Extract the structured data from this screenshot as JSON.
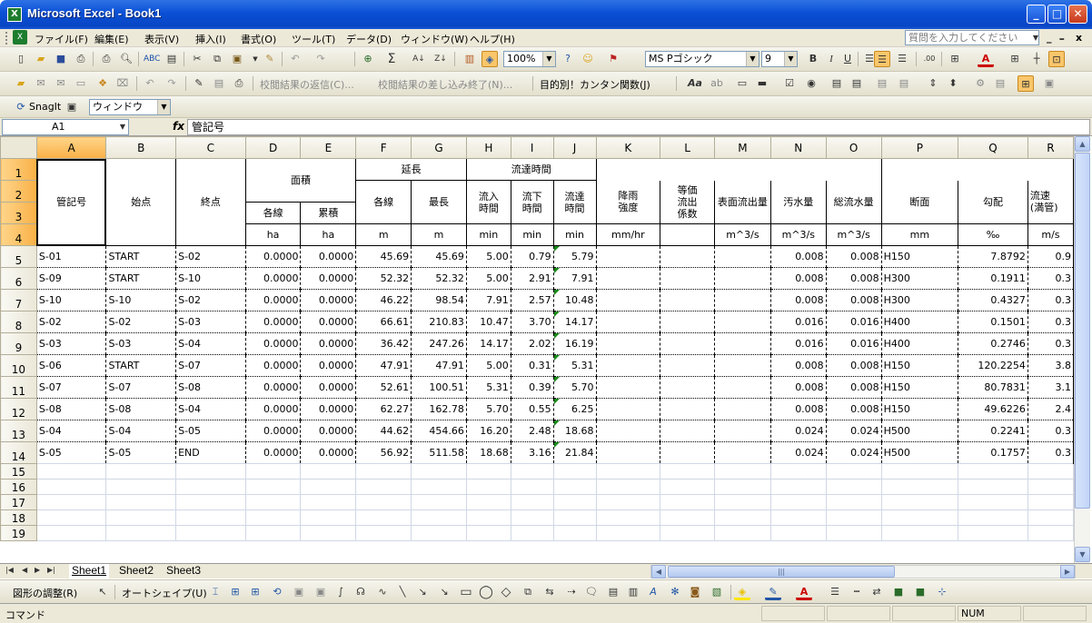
{
  "window": {
    "title": "Microsoft Excel - Book1",
    "app_icon": "X",
    "minimize": "_",
    "maximize": "□",
    "close": "✕"
  },
  "menu": {
    "items": [
      "ファイル(F)",
      "編集(E)",
      "表示(V)",
      "挿入(I)",
      "書式(O)",
      "ツール(T)",
      "データ(D)",
      "ウィンドウ(W)",
      "ヘルプ(H)"
    ],
    "help_placeholder": "質問を入力してください",
    "mdi_min": "_",
    "mdi_restore": "ｰ",
    "mdi_close": "x"
  },
  "toolbar_standard": {
    "zoom": "100%",
    "font_name": "MS Pゴシック",
    "font_size": "9",
    "bold": "B",
    "italic": "I",
    "underline": "U"
  },
  "toolbar_reviewing": {
    "reply_label": "校閲結果の返信(C)...",
    "end_label": "校閲結果の差し込み終了(N)...",
    "func_label": "目的別！カンタン関数(J)"
  },
  "toolbar_snagit": {
    "snagit_label": "SnagIt",
    "window_combo": "ウィンドウ"
  },
  "formula_bar": {
    "name_box": "A1",
    "fx": "fx",
    "content": "管記号"
  },
  "columns": [
    "A",
    "B",
    "C",
    "D",
    "E",
    "F",
    "G",
    "H",
    "I",
    "J",
    "K",
    "L",
    "M",
    "N",
    "O",
    "P",
    "Q",
    "R"
  ],
  "header": {
    "pipe_id": "管記号",
    "start": "始点",
    "end": "終点",
    "area": "面積",
    "area_each": "各線",
    "area_cum": "累積",
    "length": "延長",
    "len_each": "各線",
    "len_max": "最長",
    "flow_time": "流達時間",
    "inflow_time": "流入\n時間",
    "down_time": "流下\n時間",
    "reach_time": "流達\n時間",
    "rain": "降雨\n強度",
    "coef": "等価\n流出\n係数",
    "surface_flow": "表面流出量",
    "sewage": "汚水量",
    "total_sewage": "総流水量",
    "section": "断面",
    "slope": "勾配",
    "velocity": "流速\n(満管)"
  },
  "units": [
    "",
    "",
    "",
    "ha",
    "ha",
    "m",
    "m",
    "min",
    "min",
    "min",
    "mm/hr",
    "",
    "m^3/s",
    "m^3/s",
    "m^3/s",
    "mm",
    "‰",
    "m/s"
  ],
  "rows": [
    {
      "r": "5",
      "a": "S-01",
      "b": "START",
      "c": "S-02",
      "d": "0.0000",
      "e": "0.0000",
      "f": "45.69",
      "g": "45.69",
      "h": "5.00",
      "i": "0.79",
      "j": "5.79",
      "n": "0.008",
      "o": "0.008",
      "p": "H150",
      "q": "7.8792",
      "s": "0.9"
    },
    {
      "r": "6",
      "a": "S-09",
      "b": "START",
      "c": "S-10",
      "d": "0.0000",
      "e": "0.0000",
      "f": "52.32",
      "g": "52.32",
      "h": "5.00",
      "i": "2.91",
      "j": "7.91",
      "n": "0.008",
      "o": "0.008",
      "p": "H300",
      "q": "0.1911",
      "s": "0.3"
    },
    {
      "r": "7",
      "a": "S-10",
      "b": "S-10",
      "c": "S-02",
      "d": "0.0000",
      "e": "0.0000",
      "f": "46.22",
      "g": "98.54",
      "h": "7.91",
      "i": "2.57",
      "j": "10.48",
      "n": "0.008",
      "o": "0.008",
      "p": "H300",
      "q": "0.4327",
      "s": "0.3"
    },
    {
      "r": "8",
      "a": "S-02",
      "b": "S-02",
      "c": "S-03",
      "d": "0.0000",
      "e": "0.0000",
      "f": "66.61",
      "g": "210.83",
      "h": "10.47",
      "i": "3.70",
      "j": "14.17",
      "n": "0.016",
      "o": "0.016",
      "p": "H400",
      "q": "0.1501",
      "s": "0.3"
    },
    {
      "r": "9",
      "a": "S-03",
      "b": "S-03",
      "c": "S-04",
      "d": "0.0000",
      "e": "0.0000",
      "f": "36.42",
      "g": "247.26",
      "h": "14.17",
      "i": "2.02",
      "j": "16.19",
      "n": "0.016",
      "o": "0.016",
      "p": "H400",
      "q": "0.2746",
      "s": "0.3"
    },
    {
      "r": "10",
      "a": "S-06",
      "b": "START",
      "c": "S-07",
      "d": "0.0000",
      "e": "0.0000",
      "f": "47.91",
      "g": "47.91",
      "h": "5.00",
      "i": "0.31",
      "j": "5.31",
      "n": "0.008",
      "o": "0.008",
      "p": "H150",
      "q": "120.2254",
      "s": "3.8"
    },
    {
      "r": "11",
      "a": "S-07",
      "b": "S-07",
      "c": "S-08",
      "d": "0.0000",
      "e": "0.0000",
      "f": "52.61",
      "g": "100.51",
      "h": "5.31",
      "i": "0.39",
      "j": "5.70",
      "n": "0.008",
      "o": "0.008",
      "p": "H150",
      "q": "80.7831",
      "s": "3.1"
    },
    {
      "r": "12",
      "a": "S-08",
      "b": "S-08",
      "c": "S-04",
      "d": "0.0000",
      "e": "0.0000",
      "f": "62.27",
      "g": "162.78",
      "h": "5.70",
      "i": "0.55",
      "j": "6.25",
      "n": "0.008",
      "o": "0.008",
      "p": "H150",
      "q": "49.6226",
      "s": "2.4"
    },
    {
      "r": "13",
      "a": "S-04",
      "b": "S-04",
      "c": "S-05",
      "d": "0.0000",
      "e": "0.0000",
      "f": "44.62",
      "g": "454.66",
      "h": "16.20",
      "i": "2.48",
      "j": "18.68",
      "n": "0.024",
      "o": "0.024",
      "p": "H500",
      "q": "0.2241",
      "s": "0.3"
    },
    {
      "r": "14",
      "a": "S-05",
      "b": "S-05",
      "c": "END",
      "d": "0.0000",
      "e": "0.0000",
      "f": "56.92",
      "g": "511.58",
      "h": "18.68",
      "i": "3.16",
      "j": "21.84",
      "n": "0.024",
      "o": "0.024",
      "p": "H500",
      "q": "0.1757",
      "s": "0.3"
    }
  ],
  "empty_rows": [
    "15",
    "16",
    "17",
    "18",
    "19"
  ],
  "header_rows": [
    "1",
    "2",
    "3",
    "4"
  ],
  "sheets": [
    "Sheet1",
    "Sheet2",
    "Sheet3"
  ],
  "drawbar": {
    "draw_label": "図形の調整(R)",
    "autoshape_label": "オートシェイプ(U)"
  },
  "status": {
    "mode": "コマンド",
    "num": "NUM"
  }
}
